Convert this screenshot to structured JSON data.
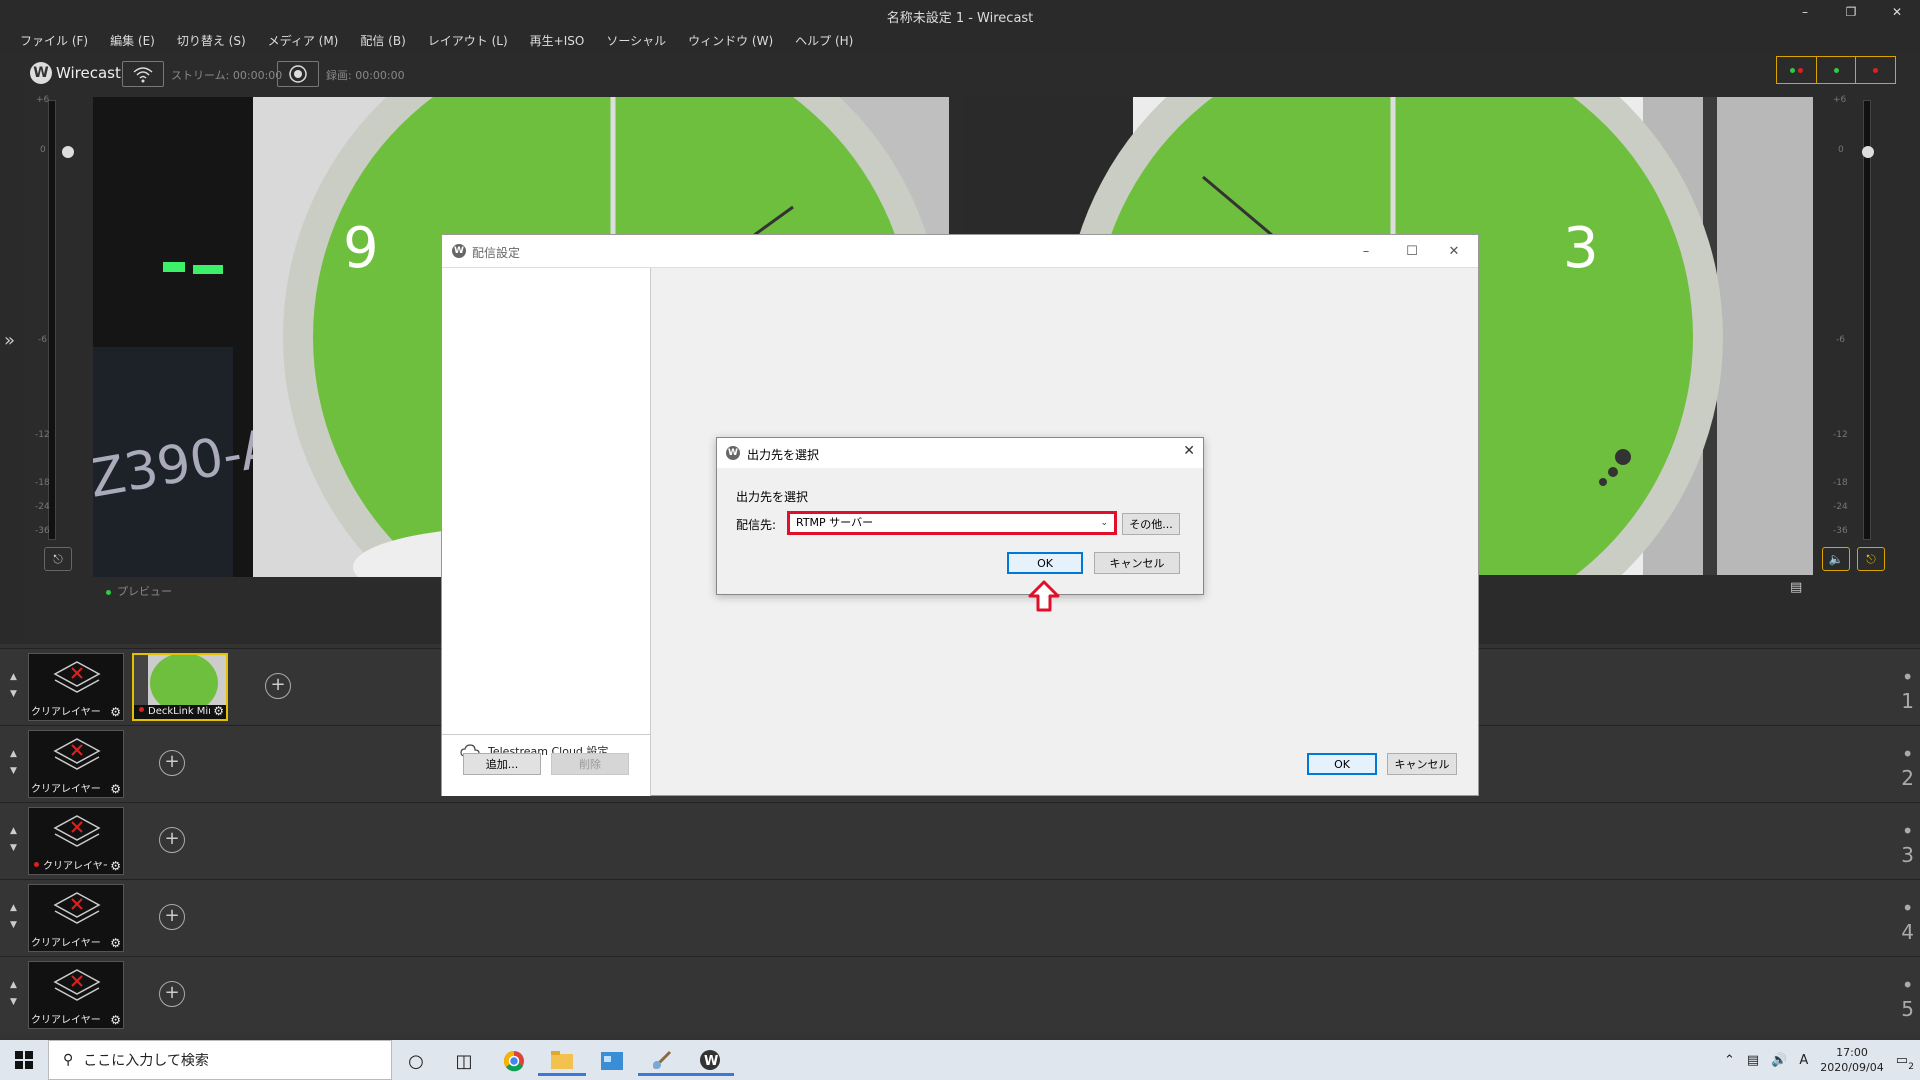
{
  "window": {
    "title": "名称未設定 1 - Wirecast"
  },
  "menu": [
    "ファイル (F)",
    "編集 (E)",
    "切り替え (S)",
    "メディア (M)",
    "配信 (B)",
    "レイアウト (L)",
    "再生+ISO",
    "ソーシャル",
    "ウィンドウ (W)",
    "ヘルプ (H)"
  ],
  "toolbar": {
    "app_name": "Wirecast",
    "stream_status": "ストリーム: 00:00:00",
    "record_status": "録画: 00:00:00"
  },
  "meter_scale": [
    "+6",
    "0",
    "-6",
    "-12",
    "-18",
    "-24",
    "-36"
  ],
  "preview_label": "プレビュー",
  "layers": [
    {
      "number": "1",
      "shots": [
        {
          "name": "クリアレイヤー",
          "selected": false,
          "live": false
        },
        {
          "name": "DeckLink Mini",
          "selected": true,
          "live": true
        }
      ]
    },
    {
      "number": "2",
      "shots": [
        {
          "name": "クリアレイヤー",
          "selected": false,
          "live": false
        }
      ]
    },
    {
      "number": "3",
      "shots": [
        {
          "name": "クリアレイヤー",
          "selected": false,
          "live": true
        }
      ]
    },
    {
      "number": "4",
      "shots": [
        {
          "name": "クリアレイヤー",
          "selected": false,
          "live": false
        }
      ]
    },
    {
      "number": "5",
      "shots": [
        {
          "name": "クリアレイヤー",
          "selected": false,
          "live": false
        }
      ]
    }
  ],
  "broadcast_dialog": {
    "title": "配信設定",
    "cloud_settings": "Telestream Cloud 設定",
    "add_button": "追加...",
    "delete_button": "削除",
    "ok_button": "OK",
    "cancel_button": "キャンセル"
  },
  "output_dialog": {
    "title": "出力先を選択",
    "heading": "出力先を選択",
    "destination_label": "配信先:",
    "destination_value": "RTMP サーバー",
    "other_button": "その他...",
    "ok_button": "OK",
    "cancel_button": "キャンセル"
  },
  "taskbar": {
    "search_placeholder": "ここに入力して検索",
    "ime": "A",
    "time": "17:00",
    "date": "2020/09/04",
    "notification_count": "2"
  },
  "colors": {
    "selection": "#e3c000",
    "highlight_red": "#e0102a",
    "accent_blue": "#0078d7"
  }
}
